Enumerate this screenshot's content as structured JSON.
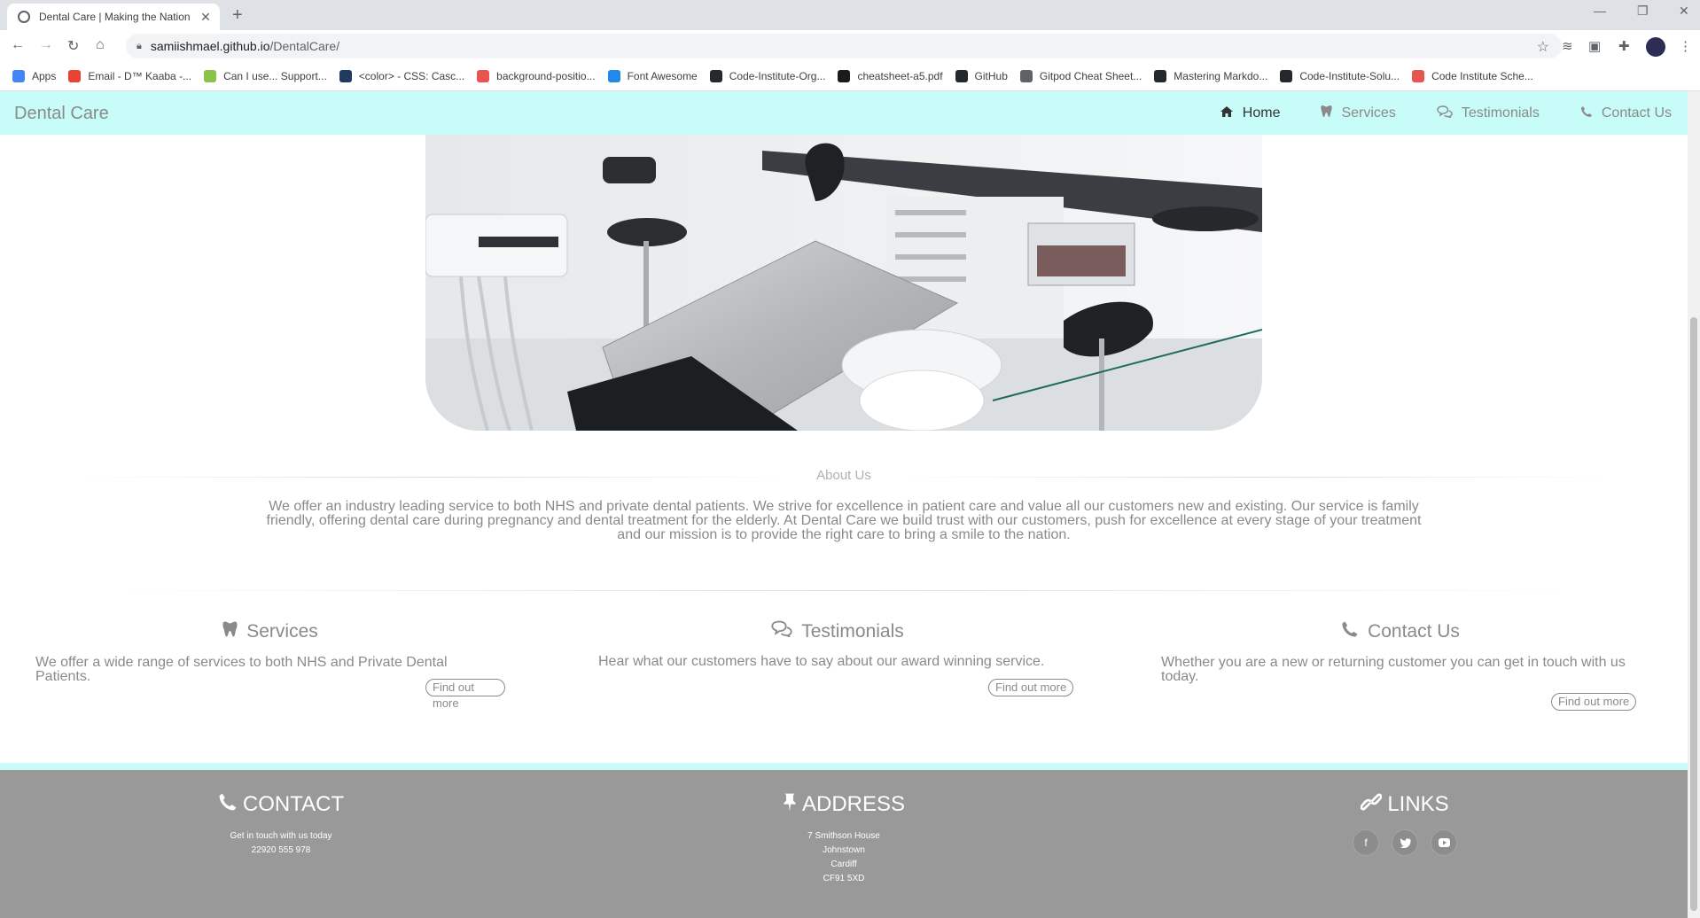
{
  "browser": {
    "tab_title": "Dental Care | Making the Nation",
    "url_host": "samiishmael.github.io",
    "url_path": "/DentalCare/",
    "bookmarks": [
      {
        "label": "Apps",
        "color": "#4285f4"
      },
      {
        "label": "Email - D™ Kaaba -...",
        "color": "#ea4335"
      },
      {
        "label": "Can I use... Support...",
        "color": "#8bc34a"
      },
      {
        "label": "<color> - CSS: Casc...",
        "color": "#1e3a5f"
      },
      {
        "label": "background-positio...",
        "color": "#e8554e"
      },
      {
        "label": "Font Awesome",
        "color": "#228ae6"
      },
      {
        "label": "Code-Institute-Org...",
        "color": "#24292e"
      },
      {
        "label": "cheatsheet-a5.pdf",
        "color": "#1b1b1b"
      },
      {
        "label": "GitHub",
        "color": "#24292e"
      },
      {
        "label": "Gitpod Cheat Sheet...",
        "color": "#5f6368"
      },
      {
        "label": "Mastering Markdo...",
        "color": "#24292e"
      },
      {
        "label": "Code-Institute-Solu...",
        "color": "#24292e"
      },
      {
        "label": "Code Institute Sche...",
        "color": "#e8554e"
      }
    ]
  },
  "nav": {
    "brand": "Dental Care",
    "links": [
      {
        "label": "Home",
        "icon": "home-icon"
      },
      {
        "label": "Services",
        "icon": "tooth-icon"
      },
      {
        "label": "Testimonials",
        "icon": "comments-icon"
      },
      {
        "label": "Contact Us",
        "icon": "phone-icon"
      }
    ]
  },
  "about": {
    "title": "About Us",
    "text": "We offer an industry leading service to both NHS and private dental patients. We strive for excellence in patient care and value all our customers new and existing. Our service is family friendly, offering dental care during pregnancy and dental treatment for the elderly. At Dental Care we build trust with our customers, push for excellence at every stage of your treatment and our mission is to provide the right care to bring a smile to the nation."
  },
  "cards": [
    {
      "title": "Services",
      "icon": "tooth-icon",
      "text": "We offer a wide range of services to both NHS and Private Dental Patients.",
      "button": "Find out more"
    },
    {
      "title": "Testimonials",
      "icon": "comments-icon",
      "text": "Hear what our customers have to say about our award winning service.",
      "button": "Find out more"
    },
    {
      "title": "Contact Us",
      "icon": "phone-icon",
      "text": "Whether you are a new or returning customer you can get in touch with us today.",
      "button": "Find out more"
    }
  ],
  "footer": {
    "contact": {
      "title": "CONTACT",
      "lines": [
        "Get in touch with us today",
        "22920 555 978"
      ]
    },
    "address": {
      "title": "ADDRESS",
      "lines": [
        "7 Smithson House",
        "Johnstown",
        "Cardiff",
        "CF91 5XD"
      ]
    },
    "links": {
      "title": "LINKS",
      "socials": [
        "facebook-icon",
        "twitter-icon",
        "youtube-icon"
      ]
    }
  },
  "colors": {
    "nav_bg": "#c8fcf8",
    "footer_bg": "#999999",
    "text_grey": "#8a8a8a"
  }
}
